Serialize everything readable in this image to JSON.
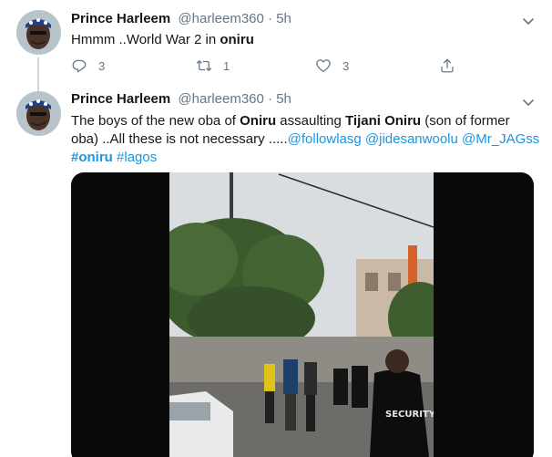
{
  "tweets": [
    {
      "name": "Prince Harleem",
      "handle": "@harleem360",
      "separator": "·",
      "time": "5h",
      "text": {
        "prefix": "Hmmm ..World War 2 in ",
        "bold": "oniru"
      },
      "actions": {
        "reply_count": "3",
        "retweet_count": "1",
        "like_count": "3"
      }
    },
    {
      "name": "Prince Harleem",
      "handle": "@harleem360",
      "separator": "·",
      "time": "5h",
      "text": {
        "part1": "The boys  of the new oba of ",
        "bold1": "Oniru",
        "part2": " assaulting ",
        "bold2": "Tijani Oniru",
        "part3": " (son of former oba) ..All these is not necessary .....",
        "mention1": "@followlasg",
        "mention2": "@jidesanwoolu",
        "mention3": "@Mr_JAGss",
        "hashtag1": "#oniru",
        "hashtag2": "#lagos"
      },
      "media": {
        "type": "video",
        "overlay_text": "SECURITY"
      }
    }
  ],
  "icons": {
    "reply": "reply-icon",
    "retweet": "retweet-icon",
    "like": "heart-icon",
    "share": "share-icon",
    "caret": "chevron-down-icon"
  },
  "colors": {
    "link": "#1b95e0",
    "secondary_text": "#657786",
    "primary_text": "#14171a",
    "thread_line": "#ccd6dd"
  }
}
